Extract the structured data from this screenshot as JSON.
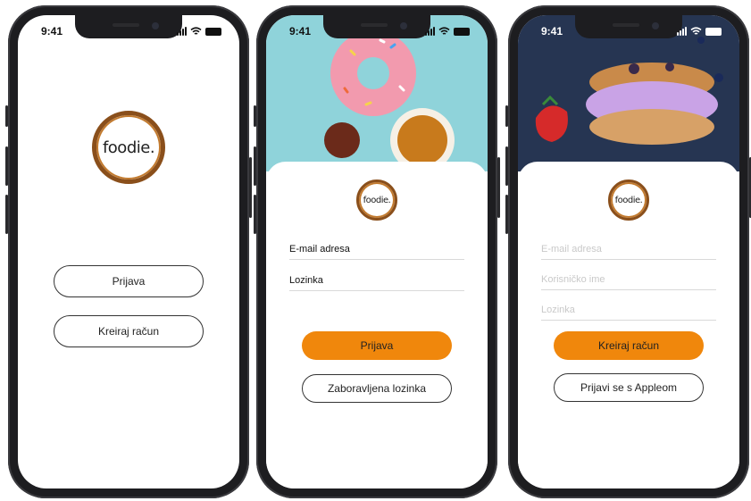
{
  "screens": [
    {
      "time": "9:41",
      "logo_text": "foodie.",
      "login_button": "Prijava",
      "create_button": "Kreiraj račun"
    },
    {
      "time": "9:41",
      "logo_text": "foodie.",
      "email_value": "E-mail adresa",
      "password_value": "Lozinka",
      "login_button": "Prijava",
      "forgot_button": "Zaboravljena lozinka"
    },
    {
      "time": "9:41",
      "logo_text": "foodie.",
      "email_placeholder": "E-mail adresa",
      "username_placeholder": "Korisničko ime",
      "password_placeholder": "Lozinka",
      "create_button": "Kreiraj račun",
      "apple_button": "Prijavi se s Appleom"
    }
  ],
  "colors": {
    "accent": "#f0870c",
    "logo_ring": "#8a4f1b",
    "screen2_bg": "#8fd3da",
    "screen3_bg": "#263552"
  },
  "icons": [
    "signal-icon",
    "wifi-icon",
    "battery-icon"
  ]
}
